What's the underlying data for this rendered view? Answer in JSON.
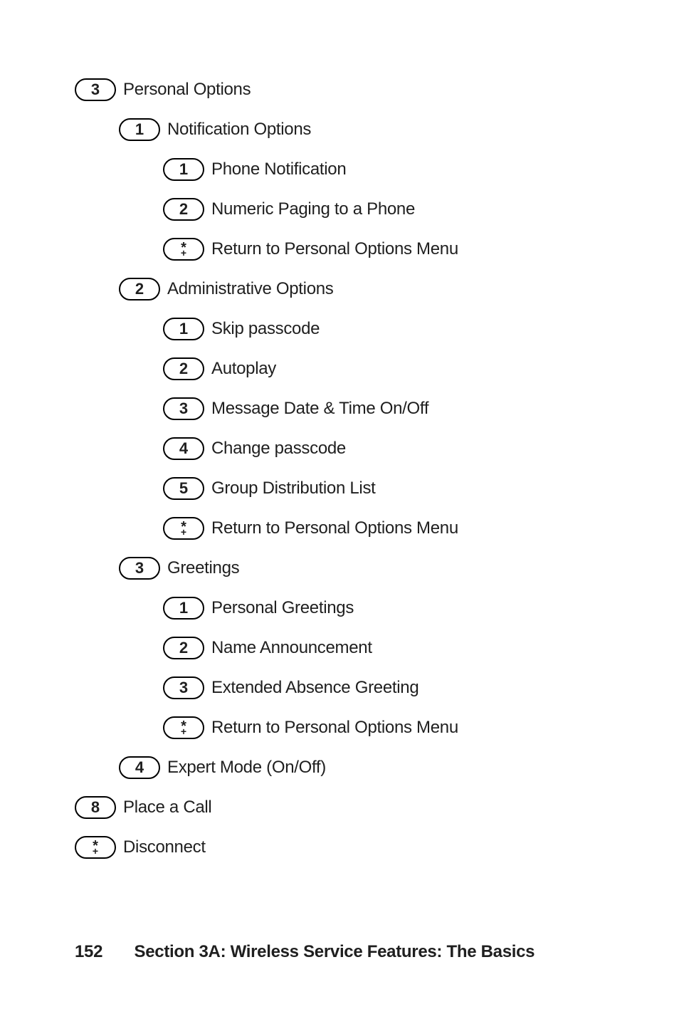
{
  "menu": [
    {
      "key": "3",
      "label": "Personal Options",
      "indent": 0
    },
    {
      "key": "1",
      "label": "Notification Options",
      "indent": 1
    },
    {
      "key": "1",
      "label": "Phone Notification",
      "indent": 2
    },
    {
      "key": "2",
      "label": "Numeric Paging to a Phone",
      "indent": 2
    },
    {
      "key": "*",
      "label": "Return to Personal Options Menu",
      "indent": 2
    },
    {
      "key": "2",
      "label": "Administrative Options",
      "indent": 1
    },
    {
      "key": "1",
      "label": "Skip passcode",
      "indent": 2
    },
    {
      "key": "2",
      "label": "Autoplay",
      "indent": 2
    },
    {
      "key": "3",
      "label": "Message Date & Time On/Off",
      "indent": 2
    },
    {
      "key": "4",
      "label": "Change passcode",
      "indent": 2
    },
    {
      "key": "5",
      "label": "Group Distribution List",
      "indent": 2
    },
    {
      "key": "*",
      "label": "Return to Personal Options Menu",
      "indent": 2
    },
    {
      "key": "3",
      "label": "Greetings",
      "indent": 1
    },
    {
      "key": "1",
      "label": "Personal Greetings",
      "indent": 2
    },
    {
      "key": "2",
      "label": "Name Announcement",
      "indent": 2
    },
    {
      "key": "3",
      "label": "Extended Absence Greeting",
      "indent": 2
    },
    {
      "key": "*",
      "label": "Return to Personal Options Menu",
      "indent": 2
    },
    {
      "key": "4",
      "label": "Expert Mode (On/Off)",
      "indent": 1
    },
    {
      "key": "8",
      "label": "Place a Call",
      "indent": 0
    },
    {
      "key": "*",
      "label": "Disconnect",
      "indent": 0
    }
  ],
  "footer": {
    "page": "152",
    "section": "Section 3A: Wireless Service Features: The Basics"
  }
}
